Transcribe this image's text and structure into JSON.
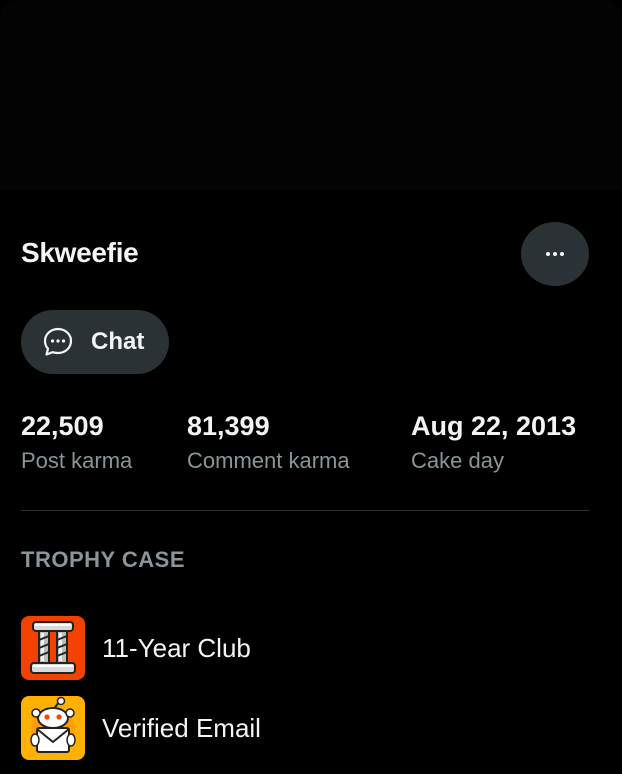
{
  "profile": {
    "username": "Skweefie",
    "more_options_icon": "ellipsis-icon",
    "chat": {
      "label": "Chat",
      "icon": "chat-bubble-icon"
    }
  },
  "stats": [
    {
      "value": "22,509",
      "label": "Post karma"
    },
    {
      "value": "81,399",
      "label": "Comment karma"
    },
    {
      "value": "Aug 22, 2013",
      "label": "Cake day"
    }
  ],
  "trophy_case": {
    "title": "TROPHY CASE",
    "trophies": [
      {
        "name": "11-Year Club",
        "icon": "eleven-year-club-icon"
      },
      {
        "name": "Verified Email",
        "icon": "verified-email-icon"
      }
    ]
  },
  "colors": {
    "background": "#000000",
    "button_bg": "#2a3236",
    "text_primary": "#f2f4f5",
    "text_secondary": "#8a9599",
    "badge_orange": "#ff4500",
    "badge_yellow": "#ffb000"
  }
}
